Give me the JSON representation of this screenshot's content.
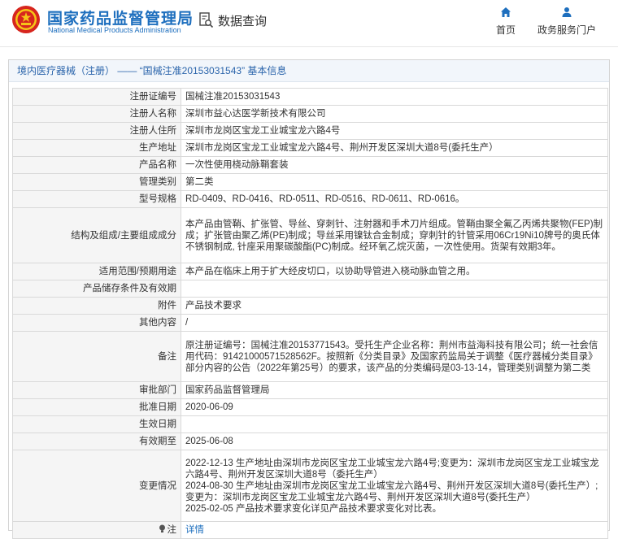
{
  "header": {
    "brand_cn": "国家药品监督管理局",
    "brand_en": "National Medical Products Administration",
    "query_label": "数据查询",
    "nav_home": "首页",
    "nav_portal": "政务服务门户"
  },
  "panel": {
    "title": "境内医疗器械（注册） —— “国械注准20153031543” 基本信息"
  },
  "rows": [
    {
      "key": "注册证编号",
      "value": "国械注准20153031543"
    },
    {
      "key": "注册人名称",
      "value": "深圳市益心达医学新技术有限公司"
    },
    {
      "key": "注册人住所",
      "value": "深圳市龙岗区宝龙工业城宝龙六路4号"
    },
    {
      "key": "生产地址",
      "value": "深圳市龙岗区宝龙工业城宝龙六路4号、荆州开发区深圳大道8号(委托生产）"
    },
    {
      "key": "产品名称",
      "value": "一次性使用桡动脉鞘套装"
    },
    {
      "key": "管理类别",
      "value": "第二类"
    },
    {
      "key": "型号规格",
      "value": "RD-0409、RD-0416、RD-0511、RD-0516、RD-0611、RD-0616。"
    },
    {
      "key": "结构及组成/主要组成成分",
      "value": "本产品由管鞘、扩张管、导丝、穿刺针、注射器和手术刀片组成。管鞘由聚全氟乙丙烯共聚物(FEP)制成；扩张管由聚乙烯(PE)制成；导丝采用镍钛合金制成；穿刺针的针管采用06Cr19Ni10牌号的奥氏体不锈钢制成, 针座采用聚碳酸酯(PC)制成。经环氧乙烷灭菌，一次性使用。货架有效期3年。"
    },
    {
      "key": "适用范围/预期用途",
      "value": "本产品在临床上用于扩大经皮切口，以协助导管进入桡动脉血管之用。"
    },
    {
      "key": "产品储存条件及有效期",
      "value": ""
    },
    {
      "key": "附件",
      "value": "产品技术要求"
    },
    {
      "key": "其他内容",
      "value": "/"
    },
    {
      "key": "备注",
      "value": "原注册证编号：国械注准20153771543。受托生产企业名称：荆州市益海科技有限公司；统一社会信用代码：91421000571528562F。按照新《分类目录》及国家药监局关于调整《医疗器械分类目录》部分内容的公告（2022年第25号）的要求，该产品的分类编码是03-13-14，管理类别调整为第二类"
    },
    {
      "key": "审批部门",
      "value": "国家药品监督管理局"
    },
    {
      "key": "批准日期",
      "value": "2020-06-09"
    },
    {
      "key": "生效日期",
      "value": ""
    },
    {
      "key": "有效期至",
      "value": "2025-06-08"
    },
    {
      "key": "变更情况",
      "value": "2022-12-13 生产地址由深圳市龙岗区宝龙工业城宝龙六路4号;变更为：深圳市龙岗区宝龙工业城宝龙六路4号、荆州开发区深圳大道8号（委托生产）\n2024-08-30 生产地址由深圳市龙岗区宝龙工业城宝龙六路4号、荆州开发区深圳大道8号(委托生产）;变更为：深圳市龙岗区宝龙工业城宝龙六路4号、荆州开发区深圳大道8号(委托生产）\n2025-02-05 产品技术要求变化详见产品技术要求变化对比表。"
    }
  ],
  "note_row": {
    "key": "注",
    "value": "详情"
  }
}
